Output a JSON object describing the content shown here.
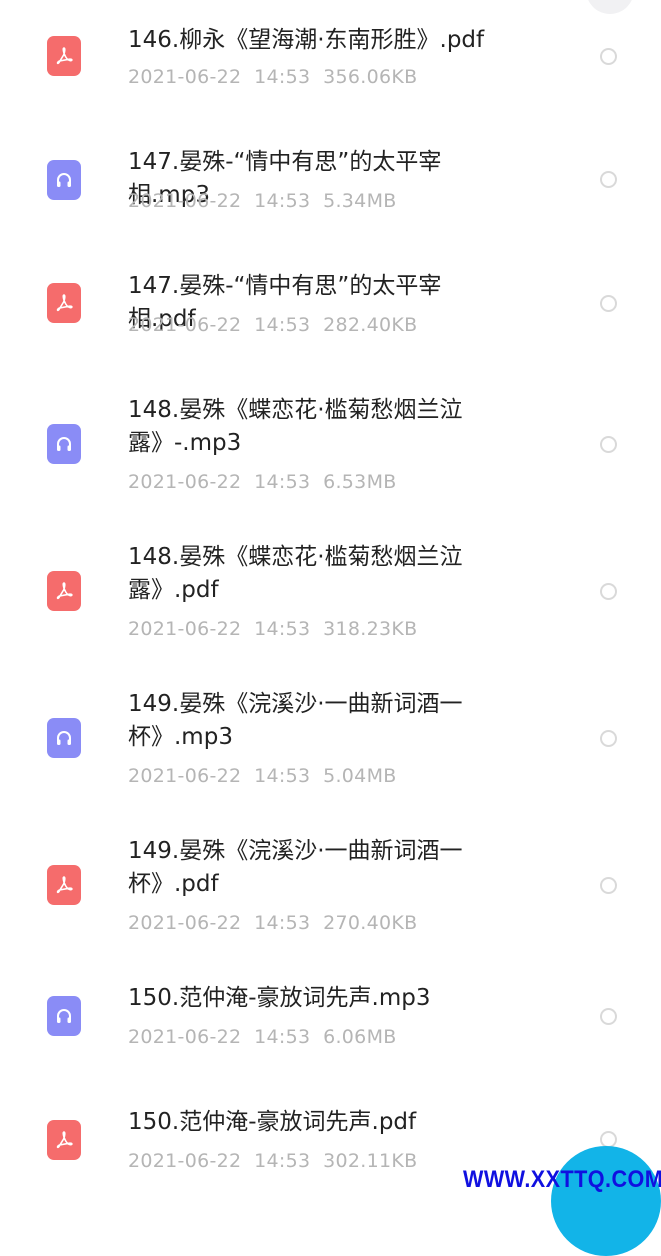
{
  "files": [
    {
      "name": "146.柳永《望海潮·东南形胜》.pdf",
      "date": "2021-06-22",
      "time": "14:53",
      "size": "356.06KB",
      "type": "pdf",
      "icon": "pdf-file-icon"
    },
    {
      "name": "147.晏殊-“情中有思”的太平宰相.mp3",
      "date": "2021-06-22",
      "time": "14:53",
      "size": "5.34MB",
      "type": "audio",
      "icon": "audio-file-icon"
    },
    {
      "name": "147.晏殊-“情中有思”的太平宰相.pdf",
      "date": "2021-06-22",
      "time": "14:53",
      "size": "282.40KB",
      "type": "pdf",
      "icon": "pdf-file-icon"
    },
    {
      "name": "148.晏殊《蝶恋花·槛菊愁烟兰泣\n露》-.mp3",
      "date": "2021-06-22",
      "time": "14:53",
      "size": "6.53MB",
      "type": "audio",
      "icon": "audio-file-icon"
    },
    {
      "name": "148.晏殊《蝶恋花·槛菊愁烟兰泣\n露》.pdf",
      "date": "2021-06-22",
      "time": "14:53",
      "size": "318.23KB",
      "type": "pdf",
      "icon": "pdf-file-icon"
    },
    {
      "name": "149.晏殊《浣溪沙·一曲新词酒一\n杯》.mp3",
      "date": "2021-06-22",
      "time": "14:53",
      "size": "5.04MB",
      "type": "audio",
      "icon": "audio-file-icon"
    },
    {
      "name": "149.晏殊《浣溪沙·一曲新词酒一\n杯》.pdf",
      "date": "2021-06-22",
      "time": "14:53",
      "size": "270.40KB",
      "type": "pdf",
      "icon": "pdf-file-icon"
    },
    {
      "name": "150.范仲淹-豪放词先声.mp3",
      "date": "2021-06-22",
      "time": "14:53",
      "size": "6.06MB",
      "type": "audio",
      "icon": "audio-file-icon"
    },
    {
      "name": "150.范仲淹-豪放词先声.pdf",
      "date": "2021-06-22",
      "time": "14:53",
      "size": "302.11KB",
      "type": "pdf",
      "icon": "pdf-file-icon"
    }
  ],
  "watermark": "WWW.XXTTQ.COM",
  "colors": {
    "pdf_icon": "#f56c6c",
    "audio_icon": "#8a8cf6",
    "fab": "#12b4e8",
    "watermark": "#1010e0"
  }
}
